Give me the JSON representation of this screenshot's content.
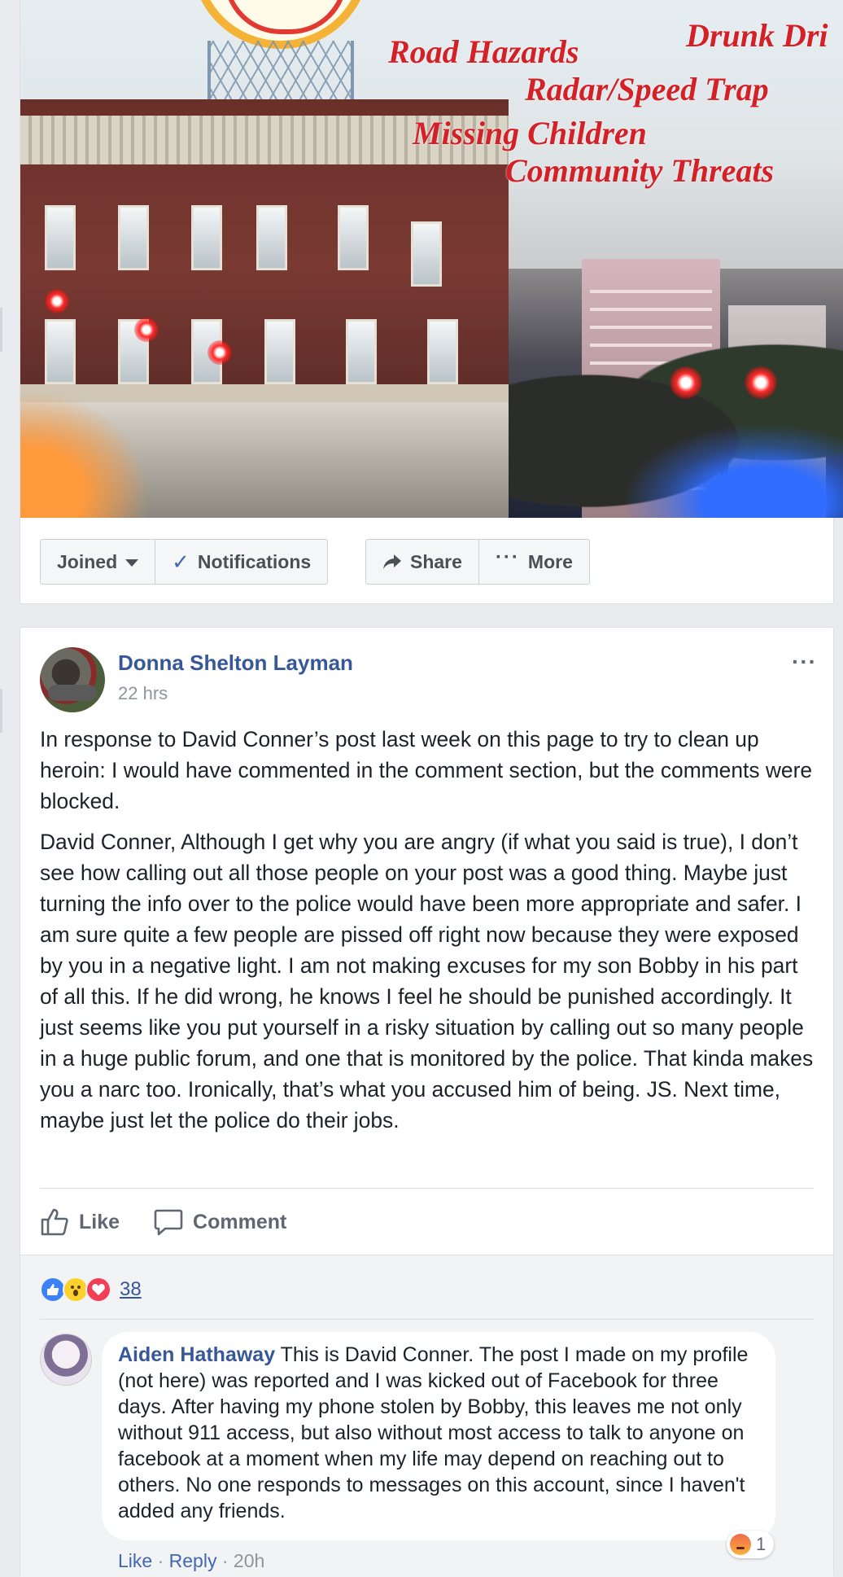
{
  "cover": {
    "overlay_lines": [
      "Road Hazards",
      "Drunk Dri",
      "Radar/Speed Trap",
      "Missing Children",
      "Community Threats"
    ]
  },
  "group_actions": {
    "joined": "Joined",
    "notifications": "Notifications",
    "share": "Share",
    "more": "More"
  },
  "post": {
    "author": "Donna Shelton Layman",
    "time": "22 hrs",
    "menu": "···",
    "paragraphs": [
      "In response to David Conner’s post last week on this page to try to clean up heroin: I would have commented in the comment section, but the comments were blocked.",
      "David Conner, Although I get why you are angry (if what you said is true), I don’t see how calling out all those people on your post was a good thing. Maybe just turning the info over to the police would have been more appropriate and safer. I am sure quite a few people are pissed off right now because they were exposed by you in a negative light. I am not making excuses for my son Bobby in his part of all this. If he did wrong, he knows I feel he should be punished accordingly. It just seems like you put yourself in a risky situation by calling out so many people in a huge public forum, and one that is monitored by the police. That kinda makes you a narc too. Ironically, that’s what you accused him of being. JS. Next time, maybe just let the police do their jobs."
    ],
    "actions": {
      "like": "Like",
      "comment": "Comment"
    },
    "reaction_count": "38"
  },
  "comment": {
    "author": "Aiden Hathaway",
    "text": "This is David Conner. The post I made on my profile (not here) was reported and I was kicked out of Facebook for three days. After having my phone stolen by Bobby, this leaves me not only without 911 access, but also without most access to talk to anyone on facebook at a moment when my life may depend on reaching out to others. No one responds to messages on this account, since I haven't added any friends.",
    "like": "Like",
    "reply": "Reply",
    "sep": " · ",
    "time": "20h",
    "reaction_count": "1"
  },
  "colors": {
    "link_blue": "#365899",
    "brand_blue": "#4267b2",
    "overlay_red": "#d42027"
  }
}
